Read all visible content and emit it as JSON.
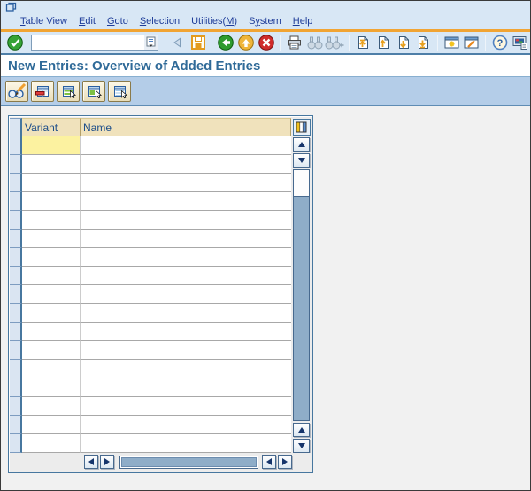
{
  "colors": {
    "panel_blue": "#d8e7f5",
    "accent_orange": "#f1a433",
    "app_bar": "#b4cde8",
    "title_blue": "#2f6a98",
    "menu_text": "#1f3d99",
    "content_gray": "#f1f1f1",
    "tbl_border": "#47779f",
    "hdr_tan": "#f0e2bc",
    "hdr_text": "#1c4d8a",
    "focus_yellow": "#fcf2a0",
    "sel_blue": "#dae5f2",
    "sb_track": "#8fadc8"
  },
  "window": {
    "icon": "sap-window-icon"
  },
  "menu_bar": {
    "items": [
      {
        "pre": "",
        "u": "T",
        "post": "able View"
      },
      {
        "pre": "",
        "u": "E",
        "post": "dit"
      },
      {
        "pre": "",
        "u": "G",
        "post": "oto"
      },
      {
        "pre": "",
        "u": "S",
        "post": "election"
      },
      {
        "pre": "Utilities(",
        "u": "M",
        "post": ")"
      },
      {
        "pre": "S",
        "u": "y",
        "post": "stem"
      },
      {
        "pre": "",
        "u": "H",
        "post": "elp"
      }
    ]
  },
  "toolbar": {
    "command_field": {
      "value": "",
      "placeholder": ""
    },
    "icons": [
      "enter-icon",
      "command-history-icon",
      "collapse-command-icon",
      "save-icon",
      "back-icon",
      "exit-icon",
      "cancel-icon",
      "print-icon",
      "find-icon",
      "find-next-icon",
      "first-page-icon",
      "previous-page-icon",
      "next-page-icon",
      "last-page-icon",
      "new-session-icon",
      "create-shortcut-icon",
      "help-icon",
      "customize-layout-icon"
    ]
  },
  "header": {
    "title": "New Entries: Overview of Added Entries"
  },
  "app_toolbar": {
    "icons": [
      "change-display-icon",
      "delete-row-icon",
      "select-all-icon",
      "select-block-icon",
      "deselect-all-icon"
    ]
  },
  "table": {
    "columns": [
      {
        "label": "Variant"
      },
      {
        "label": "Name"
      }
    ],
    "visible_row_count": 17,
    "rows": [],
    "focused_cell": {
      "row_index": 0,
      "column": "Variant"
    },
    "corner_icon": "table-settings-icon"
  }
}
